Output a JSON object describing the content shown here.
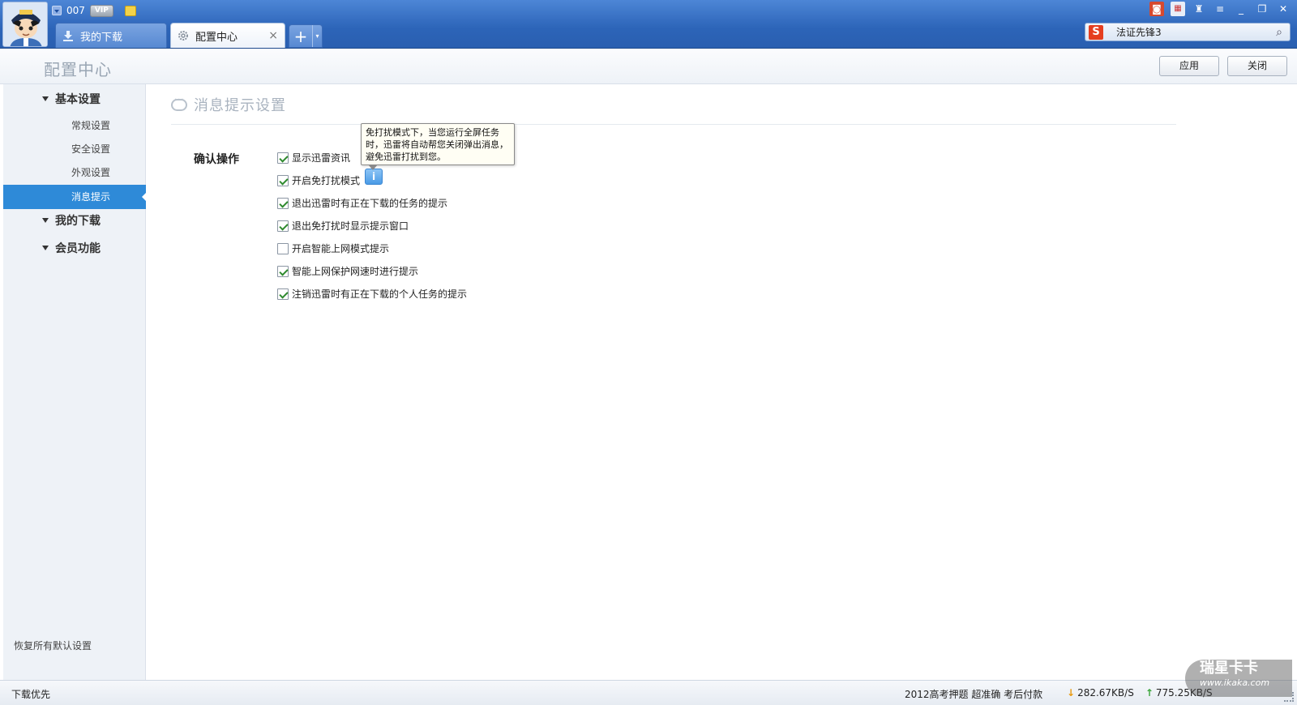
{
  "user": {
    "name": "007",
    "vip_badge": "VIP"
  },
  "tabs": [
    {
      "label": "我的下载",
      "icon": "download-icon",
      "active": false
    },
    {
      "label": "配置中心",
      "icon": "gear-icon",
      "active": true,
      "close": "×"
    }
  ],
  "new_tab": {
    "plus": "+",
    "arrow": "▾"
  },
  "search": {
    "value": "法证先锋3",
    "icon": "search-icon"
  },
  "header": {
    "title": "配置中心",
    "apply_label": "应用",
    "close_label": "关闭"
  },
  "sidebar": {
    "groups": [
      {
        "label": "基本设置",
        "items": [
          "常规设置",
          "安全设置",
          "外观设置",
          "消息提示"
        ]
      },
      {
        "label": "我的下载"
      },
      {
        "label": "会员功能"
      }
    ],
    "active_item": "消息提示",
    "restore_label": "恢复所有默认设置"
  },
  "content": {
    "section_title": "消息提示设置",
    "confirm_label": "确认操作",
    "options": [
      {
        "label": "显示迅雷资讯",
        "checked": true
      },
      {
        "label": "开启免打扰模式",
        "checked": true
      },
      {
        "label": "退出迅雷时有正在下载的任务的提示",
        "checked": true
      },
      {
        "label": "退出免打扰时显示提示窗口",
        "checked": true
      },
      {
        "label": "开启智能上网模式提示",
        "checked": false
      },
      {
        "label": "智能上网保护网速时进行提示",
        "checked": true
      },
      {
        "label": "注销迅雷时有正在下载的个人任务的提示",
        "checked": true
      }
    ],
    "info_icon": "i",
    "tooltip": "免打扰模式下，当您运行全屏任务时，迅雷将自动帮您关闭弹出消息，避免迅雷打扰到您。"
  },
  "statusbar": {
    "left": "下载优先",
    "ad": "2012高考押题 超准确 考后付款",
    "download_speed": "282.67KB/S",
    "upload_speed": "775.25KB/S"
  },
  "watermark": {
    "line1": "瑞星卡卡",
    "line2": "www.ikaka.com"
  },
  "colors": {
    "accent": "#2e8ad8",
    "titlebar": "#2c64b8"
  }
}
